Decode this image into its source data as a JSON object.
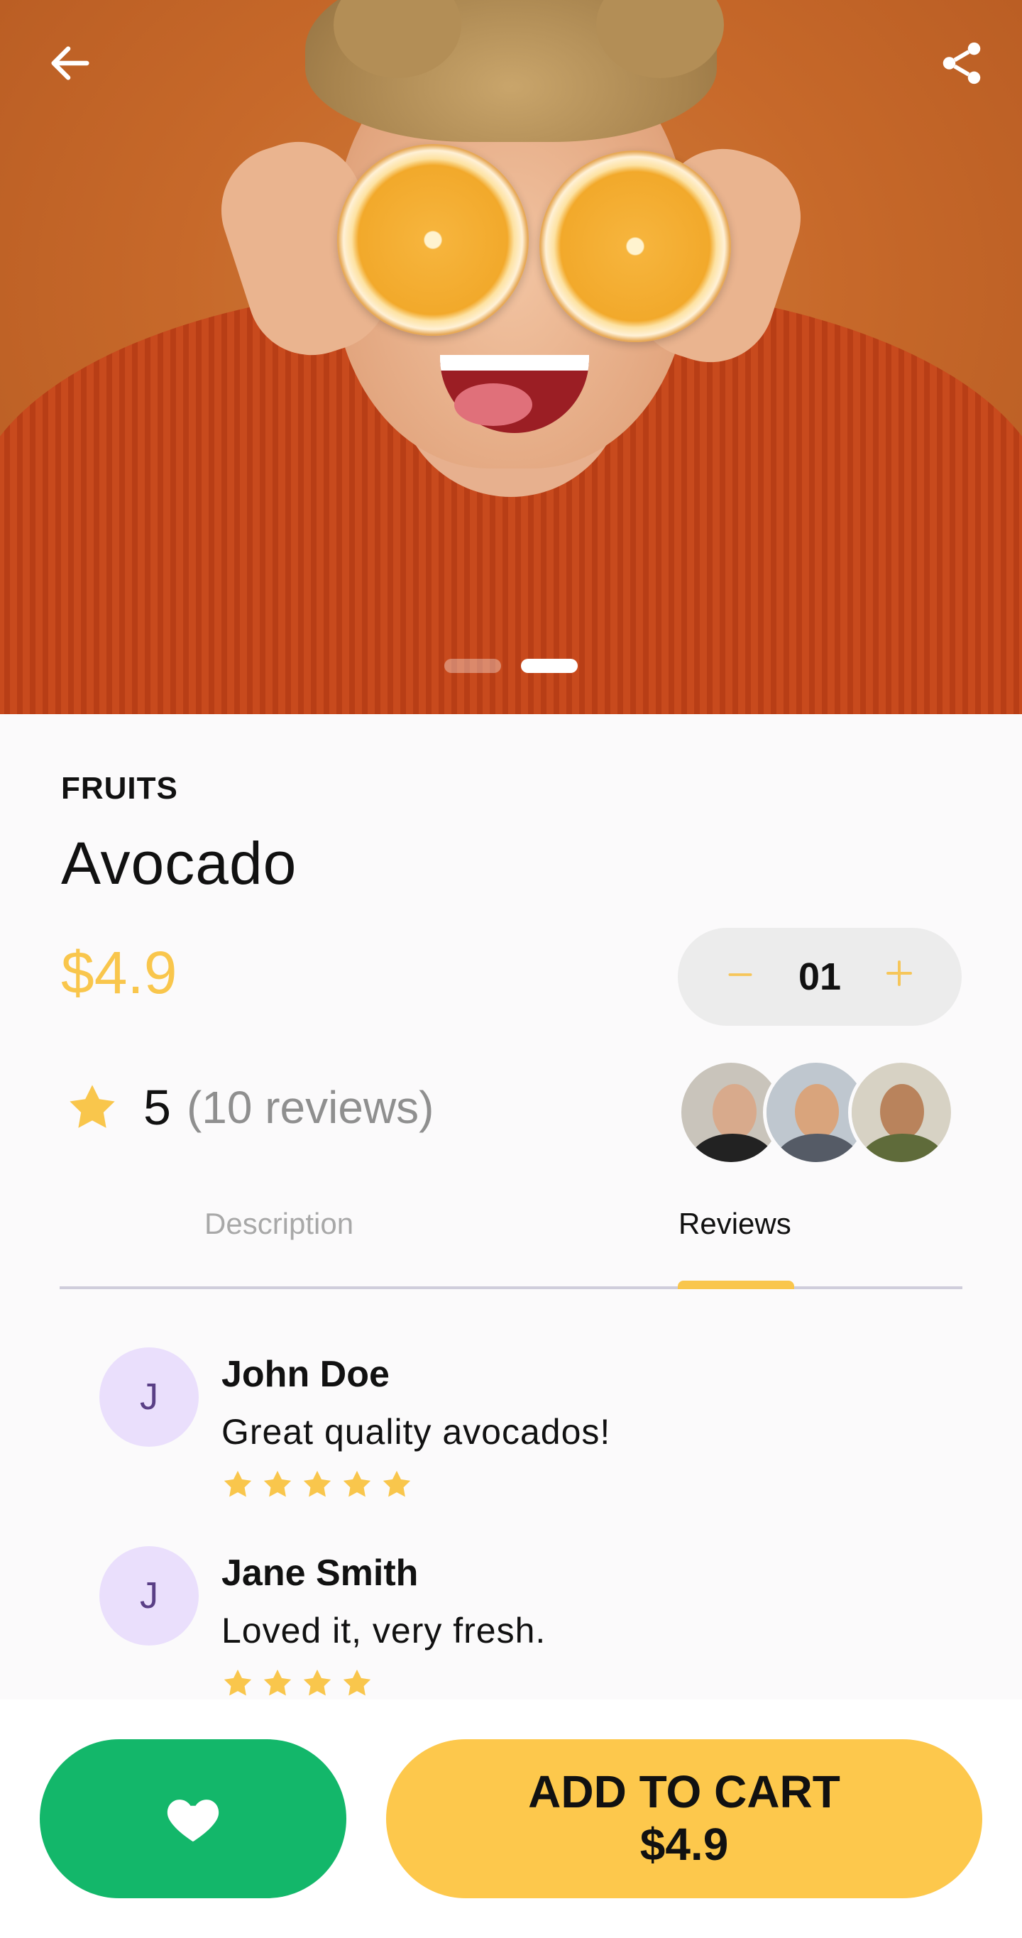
{
  "hero": {
    "image_alt": "Woman holding orange halves over her eyes",
    "pager": {
      "count": 2,
      "active_index": 1
    }
  },
  "product": {
    "category": "FRUITS",
    "name": "Avocado",
    "price": "$4.9",
    "quantity": "01",
    "rating_value": "5",
    "reviews_count": "(10 reviews)"
  },
  "tabs": [
    {
      "label": "Description",
      "active": false
    },
    {
      "label": "Reviews",
      "active": true
    }
  ],
  "reviews": [
    {
      "initial": "J",
      "name": "John Doe",
      "text": "Great quality avocados!",
      "stars": 5
    },
    {
      "initial": "J",
      "name": "Jane Smith",
      "text": "Loved it, very fresh.",
      "stars": 4
    }
  ],
  "actions": {
    "add_to_cart_label": "ADD TO CART",
    "add_to_cart_price": "$4.9"
  },
  "icons": {
    "back": "arrow-left-icon",
    "share": "share-icon",
    "star": "star-icon",
    "favorite": "heart-icon",
    "minus": "minus-icon",
    "plus": "plus-icon"
  },
  "colors": {
    "accent": "#f9c64c",
    "cart_button": "#fdc84c",
    "favorite_button": "#13b76a",
    "avatar_bg": "#eadffc",
    "muted_text": "#8f8f8f"
  }
}
